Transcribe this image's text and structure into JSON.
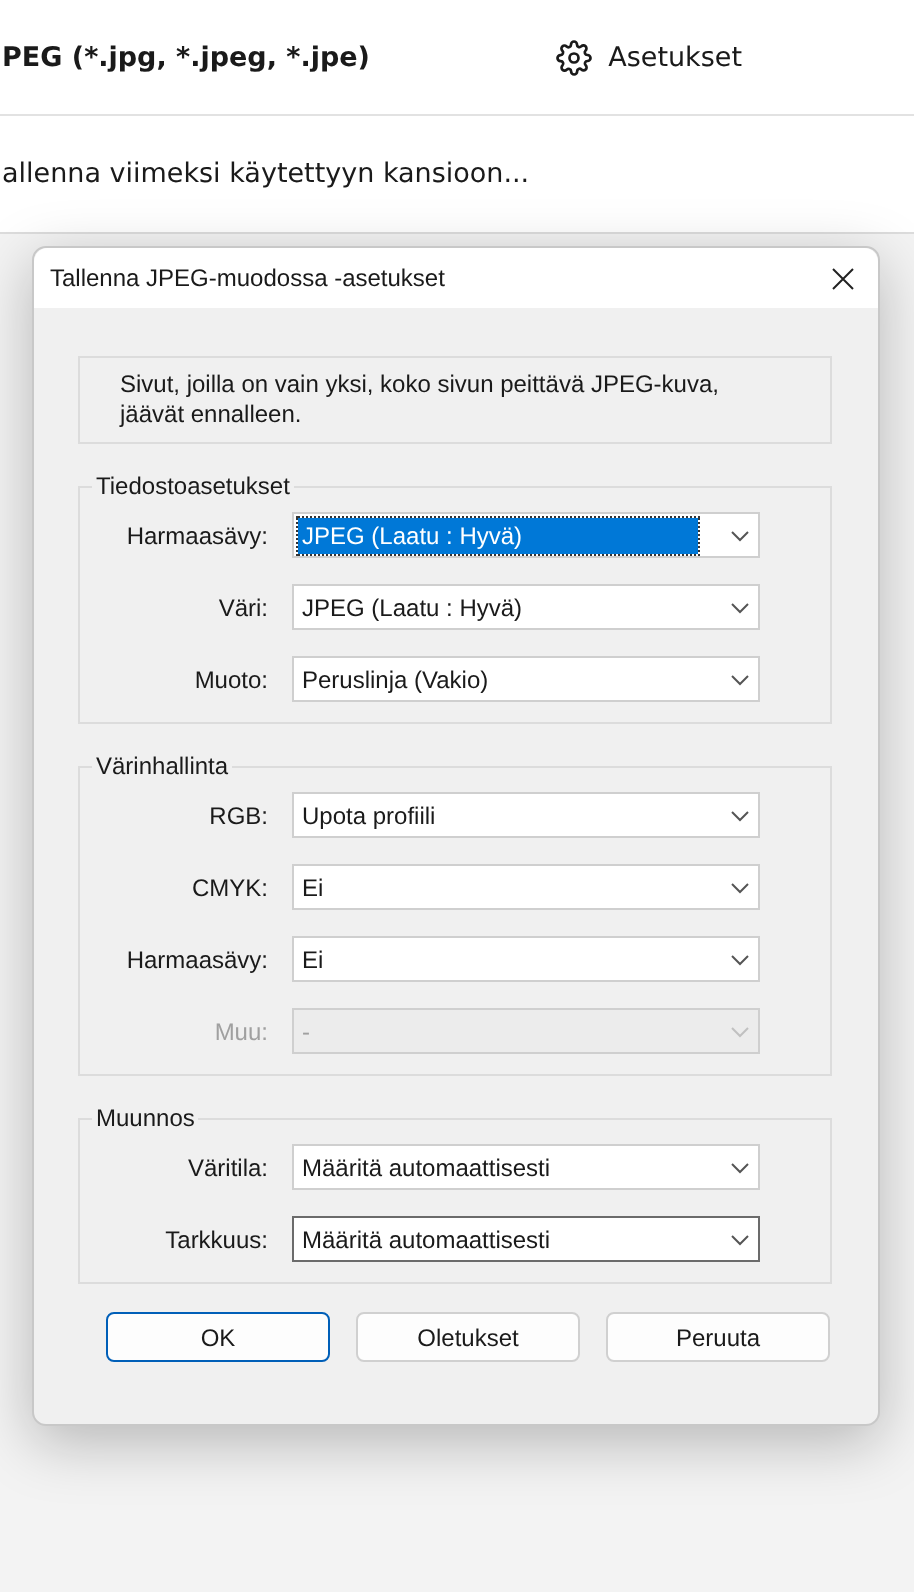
{
  "background": {
    "format_value": "PEG (*.jpg, *.jpeg, *.jpe)",
    "settings_button": "Asetukset",
    "save_option": "allenna viimeksi käytettyyn kansioon..."
  },
  "dialog": {
    "title": "Tallenna JPEG-muodossa -asetukset",
    "info": "Sivut, joilla on vain yksi, koko sivun peittävä JPEG-kuva, jäävät ennalleen.",
    "groups": [
      {
        "title": "Tiedostoasetukset",
        "fields": [
          {
            "label": "Harmaasävy:",
            "value": "JPEG (Laatu : Hyvä)",
            "highlighted": true,
            "disabled": false,
            "focused": false
          },
          {
            "label": "Väri:",
            "value": "JPEG (Laatu : Hyvä)",
            "highlighted": false,
            "disabled": false,
            "focused": false
          },
          {
            "label": "Muoto:",
            "value": "Peruslinja (Vakio)",
            "highlighted": false,
            "disabled": false,
            "focused": false
          }
        ]
      },
      {
        "title": "Värinhallinta",
        "fields": [
          {
            "label": "RGB:",
            "value": "Upota profiili",
            "highlighted": false,
            "disabled": false,
            "focused": false
          },
          {
            "label": "CMYK:",
            "value": "Ei",
            "highlighted": false,
            "disabled": false,
            "focused": false
          },
          {
            "label": "Harmaasävy:",
            "value": "Ei",
            "highlighted": false,
            "disabled": false,
            "focused": false
          },
          {
            "label": "Muu:",
            "value": "-",
            "highlighted": false,
            "disabled": true,
            "focused": false
          }
        ]
      },
      {
        "title": "Muunnos",
        "fields": [
          {
            "label": "Väritila:",
            "value": "Määritä automaattisesti",
            "highlighted": false,
            "disabled": false,
            "focused": false
          },
          {
            "label": "Tarkkuus:",
            "value": "Määritä automaattisesti",
            "highlighted": false,
            "disabled": false,
            "focused": true
          }
        ]
      }
    ],
    "buttons": [
      {
        "label": "OK",
        "default": true
      },
      {
        "label": "Oletukset",
        "default": false
      },
      {
        "label": "Peruuta",
        "default": false
      }
    ]
  }
}
